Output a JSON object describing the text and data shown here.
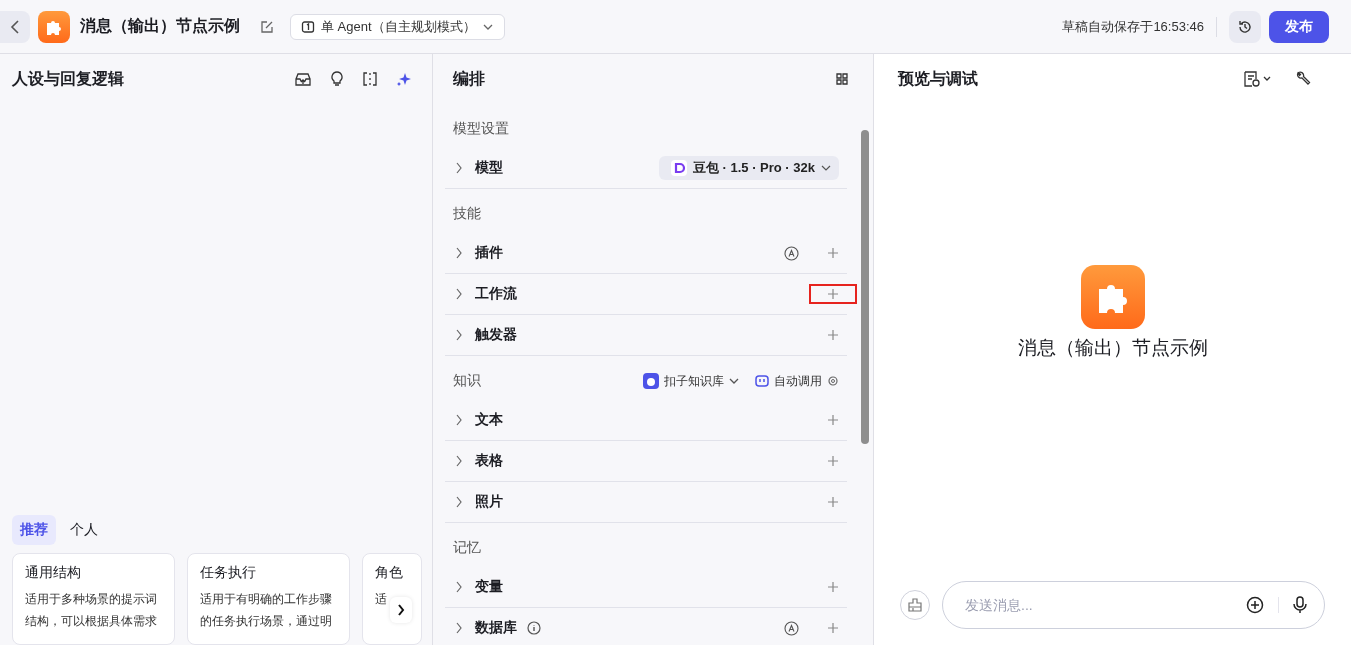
{
  "header": {
    "title": "消息（输出）节点示例",
    "mode": "单 Agent（自主规划模式）",
    "autosave": "草稿自动保存于16:53:46",
    "publish": "发布"
  },
  "left_panel": {
    "title": "人设与回复逻辑",
    "tabs": [
      {
        "label": "推荐",
        "selected": true
      },
      {
        "label": "个人",
        "selected": false
      }
    ],
    "cards": [
      {
        "title": "通用结构",
        "description": "适用于多种场景的提示词结构，可以根据具体需求"
      },
      {
        "title": "任务执行",
        "description": "适用于有明确的工作步骤的任务执行场景，通过明"
      },
      {
        "title": "角色",
        "description": "适"
      }
    ]
  },
  "middle_panel": {
    "title": "编排",
    "sections": [
      {
        "title": "模型设置",
        "rows": [
          {
            "label": "模型",
            "kind": "select",
            "value": "豆包 · 1.5 · Pro · 32k"
          }
        ]
      },
      {
        "title": "技能",
        "rows": [
          {
            "label": "插件",
            "kind": "add",
            "auto": true,
            "info": false,
            "highlighted": false
          },
          {
            "label": "工作流",
            "kind": "add",
            "auto": false,
            "info": false,
            "highlighted": true
          },
          {
            "label": "触发器",
            "kind": "add",
            "auto": false,
            "info": false,
            "highlighted": false
          }
        ]
      },
      {
        "title": "知识",
        "source": "扣子知识库",
        "invoke": "自动调用",
        "rows": [
          {
            "label": "文本",
            "kind": "add",
            "auto": false,
            "info": false,
            "highlighted": false
          },
          {
            "label": "表格",
            "kind": "add",
            "auto": false,
            "info": false,
            "highlighted": false
          },
          {
            "label": "照片",
            "kind": "add",
            "auto": false,
            "info": false,
            "highlighted": false
          }
        ]
      },
      {
        "title": "记忆",
        "rows": [
          {
            "label": "变量",
            "kind": "add",
            "auto": false,
            "info": false,
            "highlighted": false
          },
          {
            "label": "数据库",
            "kind": "add",
            "auto": true,
            "info": true,
            "highlighted": false
          }
        ]
      }
    ]
  },
  "right_panel": {
    "title": "预览与调试",
    "bot_name": "消息（输出）节点示例",
    "input_placeholder": "发送消息..."
  }
}
